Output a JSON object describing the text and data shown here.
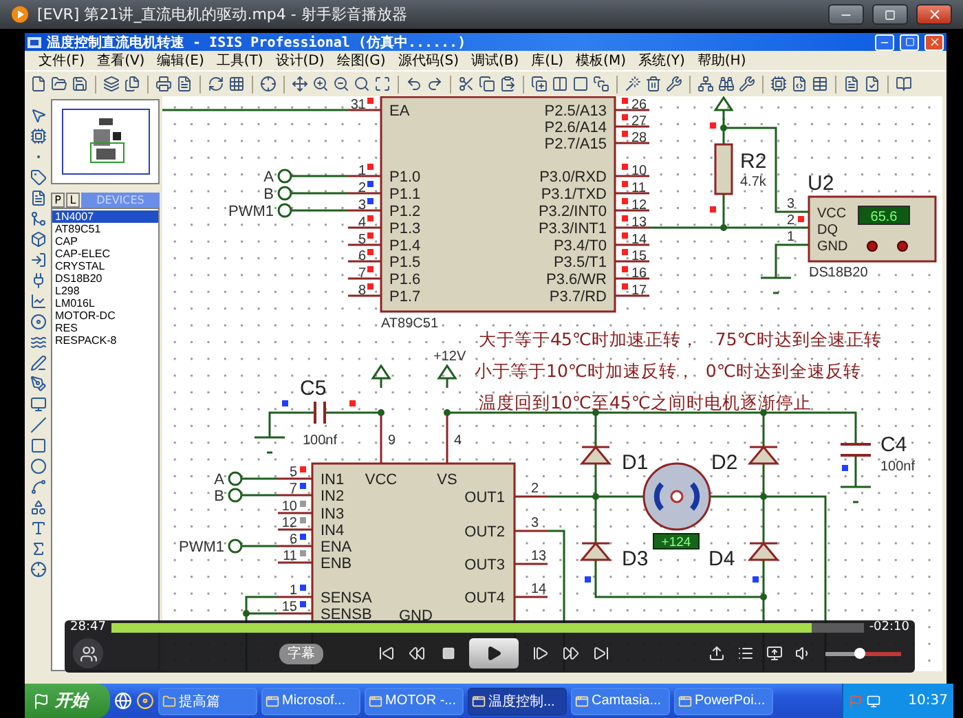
{
  "player": {
    "title": "[EVR] 第21讲_直流电机的驱动.mp4 - 射手影音播放器"
  },
  "app_window": {
    "title": "温度控制直流电机转速 - ISIS Professional (仿真中......)"
  },
  "menu": [
    "文件(F)",
    "查看(V)",
    "编辑(E)",
    "工具(T)",
    "设计(D)",
    "绘图(G)",
    "源代码(S)",
    "调试(B)",
    "库(L)",
    "模板(M)",
    "系统(Y)",
    "帮助(H)"
  ],
  "device_panel": {
    "tabs": [
      {
        "label": "P",
        "selected": false
      },
      {
        "label": "L",
        "selected": false
      }
    ],
    "header": "DEVICES",
    "devices": [
      {
        "name": "1N4007",
        "selected": true
      },
      {
        "name": "AT89C51",
        "selected": false
      },
      {
        "name": "CAP",
        "selected": false
      },
      {
        "name": "CAP-ELEC",
        "selected": false
      },
      {
        "name": "CRYSTAL",
        "selected": false
      },
      {
        "name": "DS18B20",
        "selected": false
      },
      {
        "name": "L298",
        "selected": false
      },
      {
        "name": "LM016L",
        "selected": false
      },
      {
        "name": "MOTOR-DC",
        "selected": false
      },
      {
        "name": "RES",
        "selected": false
      },
      {
        "name": "RESPACK-8",
        "selected": false
      }
    ]
  },
  "schematic": {
    "mcu": {
      "part": "AT89C51",
      "left_pins": [
        {
          "number": "31",
          "label": "EA",
          "color": "#ff2020"
        },
        {
          "number": "1",
          "label": "P1.0",
          "color": "#ff2020"
        },
        {
          "number": "2",
          "label": "P1.1",
          "color": "#2040ff"
        },
        {
          "number": "3",
          "label": "P1.2",
          "color": "#2040ff"
        },
        {
          "number": "4",
          "label": "P1.3",
          "color": "#ff2020"
        },
        {
          "number": "5",
          "label": "P1.4",
          "color": "#ff2020"
        },
        {
          "number": "6",
          "label": "P1.5",
          "color": "#ff2020"
        },
        {
          "number": "7",
          "label": "P1.6",
          "color": "#ff2020"
        },
        {
          "number": "8",
          "label": "P1.7",
          "color": "#ff2020"
        }
      ],
      "right_pins": [
        {
          "number": "26",
          "label": "P2.5/A13",
          "color": "#ff2020"
        },
        {
          "number": "27",
          "label": "P2.6/A14",
          "color": "#ff2020"
        },
        {
          "number": "28",
          "label": "P2.7/A15",
          "color": "#ff2020"
        },
        {
          "number": "10",
          "label": "P3.0/RXD",
          "color": "#ff2020"
        },
        {
          "number": "11",
          "label": "P3.1/TXD",
          "color": "#ff2020"
        },
        {
          "number": "12",
          "label": "P3.2/INT0",
          "color": "#ff2020"
        },
        {
          "number": "13",
          "label": "P3.3/INT1",
          "color": "#ff2020"
        },
        {
          "number": "14",
          "label": "P3.4/T0",
          "color": "#ff2020"
        },
        {
          "number": "15",
          "label": "P3.5/T1",
          "color": "#ff2020"
        },
        {
          "number": "16",
          "label": "P3.6/WR",
          "color": "#ff2020"
        },
        {
          "number": "17",
          "label": "P3.7/RD",
          "color": "#ff2020"
        }
      ]
    },
    "mcu_terminals": [
      {
        "label": "A"
      },
      {
        "label": "B"
      },
      {
        "label": "PWM1"
      }
    ],
    "resistor": {
      "ref": "R2",
      "value": "4.7k",
      "markers": [
        {
          "color": "#ff2020"
        },
        {
          "color": "#ff2020"
        }
      ]
    },
    "sensor": {
      "ref": "U2",
      "part": "DS18B20",
      "reading": "65.6",
      "pins": [
        {
          "number": "3",
          "label": "VCC"
        },
        {
          "number": "2",
          "label": "DQ",
          "color": "#ff2020"
        },
        {
          "number": "1",
          "label": "GND"
        }
      ]
    },
    "notes": [
      "大于等于45℃时加速正转，   75℃时达到全速正转",
      "小于等于10℃时加速反转，  0℃时达到全速反转",
      "温度回到10℃至45℃之间时电机逐渐停止"
    ],
    "supply": "+12V",
    "c5": {
      "ref": "C5",
      "value": "100nf",
      "markers": [
        {
          "color": "#2040ff"
        },
        {
          "color": "#ff2020"
        }
      ]
    },
    "c4": {
      "ref": "C4",
      "value": "100nf",
      "markers": [
        {
          "color": "#2040ff"
        }
      ]
    },
    "driver": {
      "top_pins": [
        {
          "number": "9",
          "label": "VCC"
        },
        {
          "number": "4",
          "label": "VS"
        }
      ],
      "ground_label": "GND",
      "left_pins": [
        {
          "number": "5",
          "label": "IN1",
          "color": "#ff2020"
        },
        {
          "number": "7",
          "label": "IN2",
          "color": "#2040ff"
        },
        {
          "number": "10",
          "label": "IN3",
          "color": "#9a9a9a"
        },
        {
          "number": "12",
          "label": "IN4",
          "color": "#9a9a9a"
        },
        {
          "number": "6",
          "label": "ENA",
          "color": "#2040ff"
        },
        {
          "number": "11",
          "label": "ENB",
          "color": "#9a9a9a"
        },
        {
          "number": "1",
          "label": "SENSA",
          "color": "#2040ff"
        },
        {
          "number": "15",
          "label": "SENSB",
          "color": "#2040ff"
        }
      ],
      "right_pins": [
        {
          "number": "2",
          "label": "OUT1"
        },
        {
          "number": "3",
          "label": "OUT2"
        },
        {
          "number": "13",
          "label": "OUT3"
        },
        {
          "number": "14",
          "label": "OUT4"
        }
      ]
    },
    "driver_terminals": [
      {
        "label": "A"
      },
      {
        "label": "B"
      },
      {
        "label": "PWM1"
      }
    ],
    "diodes": [
      {
        "ref": "D1"
      },
      {
        "ref": "D2"
      },
      {
        "ref": "D3",
        "color": "#2040ff"
      },
      {
        "ref": "D4",
        "color": "#2040ff"
      }
    ],
    "motor": {
      "reading": "+124"
    }
  },
  "player_controls": {
    "elapsed": "28:47",
    "remaining": "-02:10",
    "progress": {
      "level": 0.93
    },
    "subtitle_button": "字幕",
    "volume": {
      "level": 0.45
    }
  },
  "taskbar": {
    "start": "开始",
    "items": [
      {
        "label": "提高篇",
        "selected": false
      },
      {
        "label": "Microsof...",
        "selected": false
      },
      {
        "label": "MOTOR -...",
        "selected": false
      },
      {
        "label": "温度控制...",
        "selected": true
      },
      {
        "label": "Camtasia...",
        "selected": false
      },
      {
        "label": "PowerPoi...",
        "selected": false
      }
    ],
    "clock": "10:37"
  }
}
